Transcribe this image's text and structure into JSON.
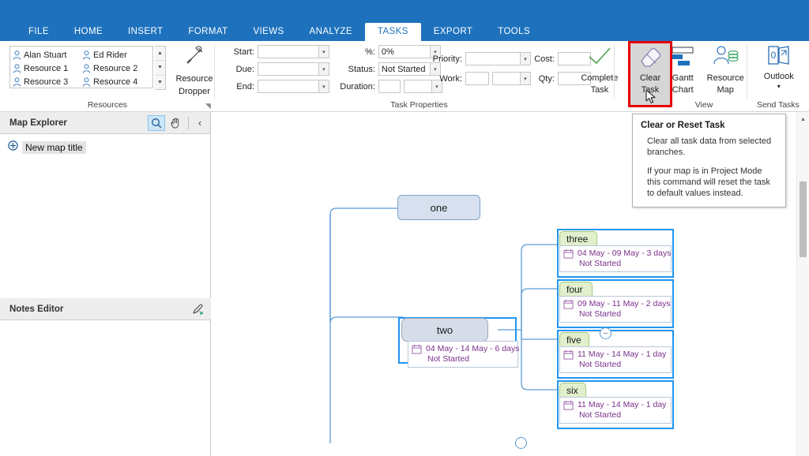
{
  "app": {
    "ribbon_tabs": [
      {
        "label": "FILE",
        "active": false
      },
      {
        "label": "HOME",
        "active": false
      },
      {
        "label": "INSERT",
        "active": false
      },
      {
        "label": "FORMAT",
        "active": false
      },
      {
        "label": "VIEWS",
        "active": false
      },
      {
        "label": "ANALYZE",
        "active": false
      },
      {
        "label": "TASKS",
        "active": true
      },
      {
        "label": "EXPORT",
        "active": false
      },
      {
        "label": "TOOLS",
        "active": false
      }
    ]
  },
  "ribbon": {
    "resources": {
      "group_label": "Resources",
      "items": [
        "Alan Stuart",
        "Ed Rider",
        "Resource 1",
        "Resource 2",
        "Resource 3",
        "Resource 4"
      ],
      "scroll_up": "▲",
      "scroll_down": "▼",
      "scroll_more": "▼",
      "dropper_label_line1": "Resource",
      "dropper_label_line2": "Dropper"
    },
    "task_properties": {
      "group_label": "Task Properties",
      "fields": [
        {
          "label": "Start:",
          "value": ""
        },
        {
          "label": "Due:",
          "value": ""
        },
        {
          "label": "End:",
          "value": ""
        },
        {
          "label": "%:",
          "value": "0%"
        },
        {
          "label": "Status:",
          "value": "Not Started"
        },
        {
          "label": "Duration:",
          "value": ""
        },
        {
          "label": "Priority:",
          "value": ""
        },
        {
          "label": "Work:",
          "value": ""
        },
        {
          "label": "Cost:",
          "value": ""
        },
        {
          "label": "Qty:",
          "value": ""
        }
      ],
      "complete_task_line1": "Complete",
      "complete_task_line2": "Task",
      "clear_task_line1": "Clear",
      "clear_task_line2": "Task"
    },
    "view": {
      "group_label": "View",
      "gantt_line1": "Gantt",
      "gantt_line2": "Chart",
      "resourcemap_line1": "Resource",
      "resourcemap_line2": "Map"
    },
    "send_tasks": {
      "group_label": "Send Tasks",
      "outlook_label": "Outlook",
      "outlook_caret": "▾",
      "outlook_glyph": "0"
    }
  },
  "tooltip": {
    "title": "Clear or Reset Task",
    "paragraph1": "Clear all task data from selected branches.",
    "paragraph2": "If your map is in Project Mode this command will reset the task to default values instead."
  },
  "sidebar": {
    "map_explorer": {
      "title": "Map Explorer",
      "search_icon": "search-icon",
      "pan_icon": "hand-icon",
      "collapse_icon": "‹"
    },
    "tree": {
      "expand_icon": "⊕",
      "root_label": "New map title"
    },
    "notes_editor": {
      "title": "Notes Editor",
      "edit_icon": "pencil-icon"
    }
  },
  "map": {
    "nodes": [
      {
        "id": "one",
        "title": "one",
        "dates": "",
        "status": "",
        "selected": false
      },
      {
        "id": "two",
        "title": "two",
        "dates": "04 May - 14 May - 6 days",
        "status": "Not Started",
        "selected": true
      },
      {
        "id": "three",
        "title": "three",
        "dates": "04 May - 09 May - 3 days",
        "status": "Not Started",
        "selected": true
      },
      {
        "id": "four",
        "title": "four",
        "dates": "09 May - 11 May - 2 days",
        "status": "Not Started",
        "selected": true
      },
      {
        "id": "five",
        "title": "five",
        "dates": "11 May - 14 May - 1 day",
        "status": "Not Started",
        "selected": true
      },
      {
        "id": "six",
        "title": "six",
        "dates": "11 May - 14 May - 1 day",
        "status": "Not Started",
        "selected": true
      }
    ],
    "collapse_toggle": "–"
  },
  "colors": {
    "ribbon_blue": "#1e72bd",
    "highlight_red": "#e60000",
    "selection_blue": "#2196f3",
    "task_text_purple": "#7a2f8a",
    "node_green": "#e2efcd",
    "node_blue": "#d6e0ee"
  }
}
